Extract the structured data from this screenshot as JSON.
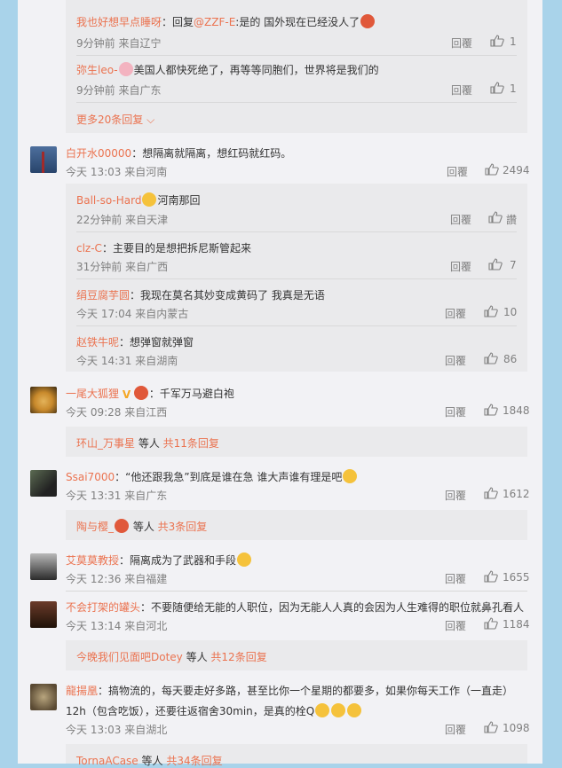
{
  "reply_label": "回覆",
  "comments": {
    "c1": {
      "r1": {
        "user": "我也好想早点睡呀",
        "pre": "：回复",
        "mention": "@ZZF-E",
        "text": ":是的 国外现在已经没人了",
        "time": "9分钟前 来自辽宁",
        "likes": "1"
      },
      "r2": {
        "user": "弥生leo-",
        "text": "美国人都快死绝了，再等等同胞们，世界将是我们的",
        "time": "9分钟前 来自广东",
        "likes": "1"
      },
      "more": "更多20条回复"
    },
    "c2": {
      "user": "白开水00000",
      "text": "：想隔离就隔离，想红码就红码。",
      "time": "今天 13:03 来自河南",
      "likes": "2494",
      "r1": {
        "user": "Ball-so-Hard",
        "text": "河南那回",
        "time": "22分钟前 来自天津",
        "likes": "讚"
      },
      "r2": {
        "user": "clz-C",
        "text": "：主要目的是想把拆尼斯管起来",
        "time": "31分钟前 来自广西",
        "likes": "7"
      },
      "r3": {
        "user": "绢豆腐芋圆",
        "text": "：我现在莫名其妙变成黄码了 我真是无语",
        "time": "今天 17:04 来自内蒙古",
        "likes": "10"
      },
      "r4": {
        "user": "赵铁牛呢",
        "text": "：想弹窗就弹窗",
        "time": "今天 14:31 来自湖南",
        "likes": "86"
      }
    },
    "c3": {
      "user": "一尾大狐狸",
      "text": "：千军万马避白袍",
      "time": "今天 09:28 来自江西",
      "likes": "1848",
      "sum_user": "环山_万事星",
      "sum_mid": " 等人 ",
      "sum_count": "共11条回复"
    },
    "c4": {
      "user": "Ssai7000",
      "text": "：“他还跟我急”到底是谁在急 谁大声谁有理是吧",
      "time": "今天 13:31 来自广东",
      "likes": "1612",
      "sum_user": "陶与樱_",
      "sum_mid": " 等人 ",
      "sum_count": "共3条回复"
    },
    "c5": {
      "user": "艾莫莫教授",
      "text": "：隔离成为了武器和手段",
      "time": "今天 12:36 来自福建",
      "likes": "1655"
    },
    "c6": {
      "user": "不会打架的罐头",
      "text": "：不要随便给无能的人职位，因为无能人人真的会因为人生难得的职位就鼻孔看人",
      "time": "今天 13:14 来自河北",
      "likes": "1184",
      "sum_user": "今晚我们见面吧Dotey",
      "sum_mid": " 等人 ",
      "sum_count": "共12条回复"
    },
    "c7": {
      "user": "龍揚凰",
      "text": "：搞物流的，每天要走好多路，甚至比你一个星期的都要多，如果你每天工作（一直走）",
      "text2": "12h（包含吃饭），还要往返宿舍30min，是真的栓Q",
      "time": "今天 13:03 来自湖北",
      "likes": "1098",
      "sum_user": "TornaACase",
      "sum_mid": " 等人 ",
      "sum_count": "共34条回复"
    }
  },
  "colors": {
    "accent": "#eb7350",
    "page_bg": "#a9d3ea",
    "panel_bg": "#f2f2f5",
    "sub_bg": "#eaeaec"
  }
}
